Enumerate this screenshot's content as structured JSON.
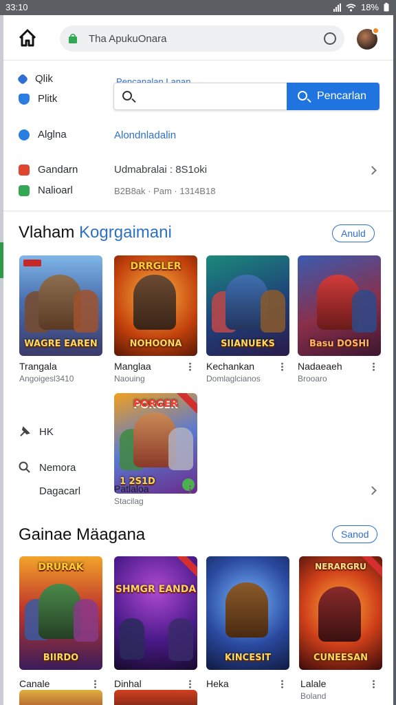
{
  "status": {
    "time": "33:10",
    "battery": "18%"
  },
  "topbar": {
    "url_text": "Tha ApukuOnara"
  },
  "side_links": [
    {
      "label": "Qlik",
      "icon": "compass-icon",
      "color": "#2f6fd6"
    },
    {
      "label": "Plitk",
      "icon": "shield-icon",
      "color": "#2a7de1"
    },
    {
      "label": "Alglna",
      "icon": "play-icon",
      "color": "#2a7de1"
    },
    {
      "label": "Gandarn",
      "icon": "flame-icon",
      "color": "#e0452f"
    },
    {
      "label": "Nalioarl",
      "icon": "store-icon",
      "color": "#35a853"
    }
  ],
  "search": {
    "caption": "Pencanalan Lanan",
    "placeholder": "",
    "button_label": "Pencarlan"
  },
  "info": {
    "link": "Alondnladalin",
    "line1": "Udmabralai : 8S1oki",
    "line2": "B2B8ak · Pam · 1314B18"
  },
  "section1": {
    "title_plain": "Vlaham",
    "title_accent": "Kogrgaimani",
    "pill": "Anuld",
    "games": [
      {
        "name": "Trangala",
        "sub": "Angoigesl3410",
        "art_title": "WAGRE EAREN",
        "top_title": ""
      },
      {
        "name": "Manglaa",
        "sub": "Naouing",
        "art_title": "NOHOONA",
        "top_title": "DRRGLER"
      },
      {
        "name": "Kechankan",
        "sub": "Domlaglcianos",
        "art_title": "SIIANUEKS",
        "top_title": ""
      },
      {
        "name": "Nadaeaeh",
        "sub": "Brooaro",
        "art_title": "Basu DOSHI",
        "top_title": ""
      },
      {
        "name": "Patlaloa",
        "sub": "Stacilag",
        "art_title": "1 2S1D",
        "top_title": "PORGER"
      }
    ]
  },
  "mid_links": [
    {
      "label": "HK",
      "icon": "pin-icon"
    },
    {
      "label": "Nemora",
      "icon": "search-icon"
    },
    {
      "label": "Dagacarl",
      "icon": ""
    }
  ],
  "section2": {
    "title": "Gainae Mäagana",
    "pill": "Sanod",
    "games": [
      {
        "name": "Canale",
        "art_title": "BIIRDO",
        "top_title": "DRURAK"
      },
      {
        "name": "Dinhal",
        "art_title": "",
        "top_title": "SHMGR EANDA"
      },
      {
        "name": "Heka",
        "art_title": "KINCESIT",
        "top_title": ""
      },
      {
        "name": "Lalale",
        "sub": "Boland",
        "art_title": "CUNEESAN",
        "top_title": "NERARGRU"
      }
    ]
  },
  "colors": {
    "accent": "#1f74e0",
    "link": "#2d6fc9"
  }
}
